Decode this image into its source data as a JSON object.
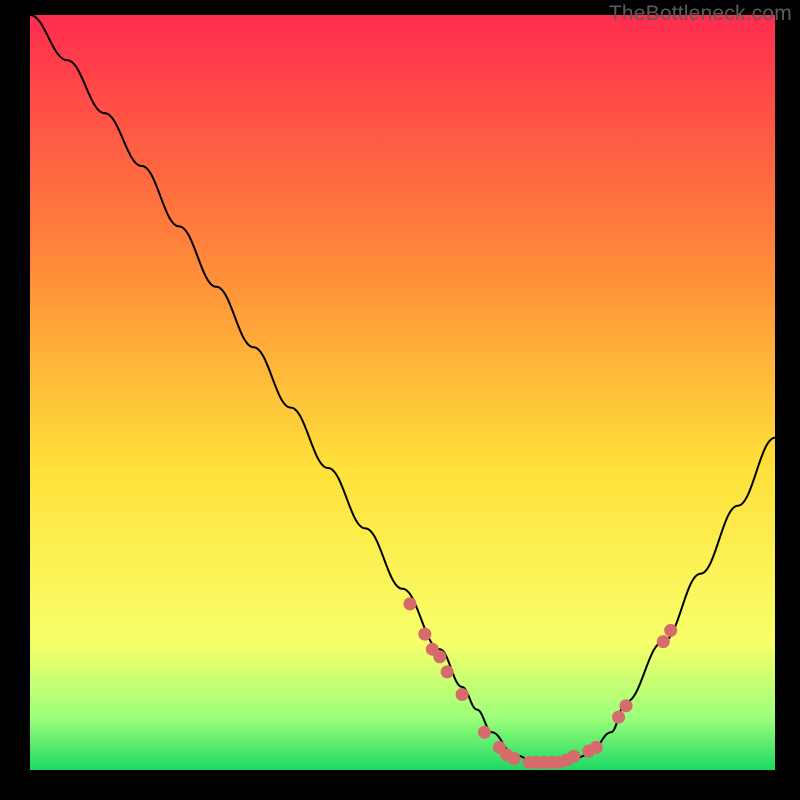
{
  "watermark": "TheBottleneck.com",
  "colors": {
    "bg": "#000000",
    "grad_top": "#ff2c4e",
    "grad_mid1": "#ff8a3a",
    "grad_mid2": "#ffe13a",
    "grad_low": "#f8ff6a",
    "grad_green_light": "#9dff7a",
    "grad_green": "#1dd964",
    "curve": "#000000",
    "dot": "#d76a6b",
    "watermark": "#5b5b5b"
  },
  "chart_data": {
    "type": "line",
    "title": "",
    "xlabel": "",
    "ylabel": "",
    "xlim": [
      0,
      100
    ],
    "ylim": [
      0,
      100
    ],
    "series": [
      {
        "name": "bottleneck-curve",
        "x": [
          0,
          5,
          10,
          15,
          20,
          25,
          30,
          35,
          40,
          45,
          50,
          55,
          58,
          60,
          62,
          65,
          68,
          70,
          72,
          75,
          78,
          80,
          85,
          90,
          95,
          100
        ],
        "y": [
          100,
          94,
          87,
          80,
          72,
          64,
          56,
          48,
          40,
          32,
          24,
          16,
          11,
          8,
          5,
          2,
          1,
          1,
          1,
          2,
          5,
          9,
          17,
          26,
          35,
          44
        ]
      }
    ],
    "highlight_points": [
      {
        "x": 51,
        "y": 22
      },
      {
        "x": 53,
        "y": 18
      },
      {
        "x": 54,
        "y": 16
      },
      {
        "x": 55,
        "y": 15
      },
      {
        "x": 56,
        "y": 13
      },
      {
        "x": 58,
        "y": 10
      },
      {
        "x": 61,
        "y": 5
      },
      {
        "x": 63,
        "y": 3
      },
      {
        "x": 64,
        "y": 2
      },
      {
        "x": 65,
        "y": 1.5
      },
      {
        "x": 67,
        "y": 1
      },
      {
        "x": 68,
        "y": 1
      },
      {
        "x": 69,
        "y": 1
      },
      {
        "x": 70,
        "y": 1
      },
      {
        "x": 71,
        "y": 1
      },
      {
        "x": 72,
        "y": 1.3
      },
      {
        "x": 73,
        "y": 1.8
      },
      {
        "x": 75,
        "y": 2.5
      },
      {
        "x": 76,
        "y": 3
      },
      {
        "x": 79,
        "y": 7
      },
      {
        "x": 80,
        "y": 8.5
      },
      {
        "x": 85,
        "y": 17
      },
      {
        "x": 86,
        "y": 18.5
      }
    ],
    "gradient_stops": [
      {
        "offset": 0.0,
        "key": "grad_top"
      },
      {
        "offset": 0.33,
        "key": "grad_mid1"
      },
      {
        "offset": 0.6,
        "key": "grad_mid2"
      },
      {
        "offset": 0.83,
        "key": "grad_low"
      },
      {
        "offset": 0.93,
        "key": "grad_green_light"
      },
      {
        "offset": 1.0,
        "key": "grad_green"
      }
    ]
  }
}
